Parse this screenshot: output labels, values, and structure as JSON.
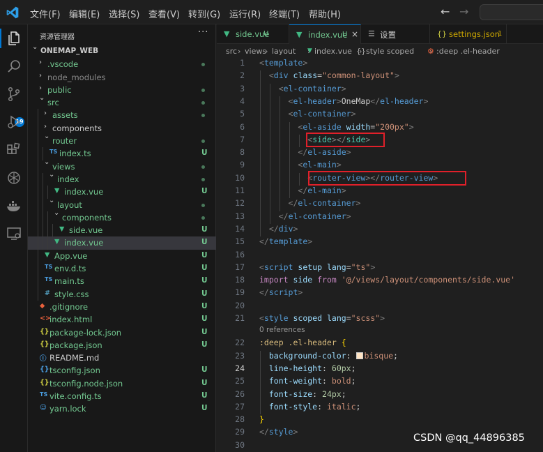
{
  "menu": [
    "文件(F)",
    "编辑(E)",
    "选择(S)",
    "查看(V)",
    "转到(G)",
    "运行(R)",
    "终端(T)",
    "帮助(H)"
  ],
  "activity": {
    "scm_badge": "19"
  },
  "sidebar": {
    "title": "资源管理器",
    "more": "···",
    "project": "ONEMAP_WEB",
    "items": [
      {
        "label": ".vscode",
        "indent": 1,
        "kind": "folder-closed",
        "status": "dot"
      },
      {
        "label": "node_modules",
        "indent": 1,
        "kind": "folder-closed",
        "status": "",
        "dim": true
      },
      {
        "label": "public",
        "indent": 1,
        "kind": "folder-closed",
        "status": "dot"
      },
      {
        "label": "src",
        "indent": 1,
        "kind": "folder-open",
        "status": "dot"
      },
      {
        "label": "assets",
        "indent": 2,
        "kind": "folder-closed",
        "status": "dot"
      },
      {
        "label": "components",
        "indent": 2,
        "kind": "folder-closed",
        "status": ""
      },
      {
        "label": "router",
        "indent": 2,
        "kind": "folder-open",
        "status": "dot"
      },
      {
        "label": "index.ts",
        "indent": 3,
        "kind": "ts",
        "status": "U"
      },
      {
        "label": "views",
        "indent": 2,
        "kind": "folder-open",
        "status": "dot"
      },
      {
        "label": "index",
        "indent": 3,
        "kind": "folder-open",
        "status": "dot"
      },
      {
        "label": "index.vue",
        "indent": 4,
        "kind": "vue",
        "status": "U"
      },
      {
        "label": "layout",
        "indent": 3,
        "kind": "folder-open",
        "status": "dot"
      },
      {
        "label": "components",
        "indent": 4,
        "kind": "folder-open",
        "status": "dot"
      },
      {
        "label": "side.vue",
        "indent": 5,
        "kind": "vue",
        "status": "U"
      },
      {
        "label": "index.vue",
        "indent": 4,
        "kind": "vue",
        "status": "U",
        "selected": true
      },
      {
        "label": "App.vue",
        "indent": 2,
        "kind": "vue",
        "status": "U"
      },
      {
        "label": "env.d.ts",
        "indent": 2,
        "kind": "ts",
        "status": "U"
      },
      {
        "label": "main.ts",
        "indent": 2,
        "kind": "ts",
        "status": "U"
      },
      {
        "label": "style.css",
        "indent": 2,
        "kind": "css",
        "status": "U"
      },
      {
        "label": ".gitignore",
        "indent": 1,
        "kind": "git",
        "status": "U"
      },
      {
        "label": "index.html",
        "indent": 1,
        "kind": "html",
        "status": "U"
      },
      {
        "label": "package-lock.json",
        "indent": 1,
        "kind": "json",
        "status": "U"
      },
      {
        "label": "package.json",
        "indent": 1,
        "kind": "json",
        "status": "U"
      },
      {
        "label": "README.md",
        "indent": 1,
        "kind": "md",
        "status": ""
      },
      {
        "label": "tsconfig.json",
        "indent": 1,
        "kind": "tsconfig",
        "status": "U"
      },
      {
        "label": "tsconfig.node.json",
        "indent": 1,
        "kind": "json",
        "status": "U"
      },
      {
        "label": "vite.config.ts",
        "indent": 1,
        "kind": "vite",
        "status": "U"
      },
      {
        "label": "yarn.lock",
        "indent": 1,
        "kind": "yarn",
        "status": "U"
      }
    ]
  },
  "tabs": [
    {
      "label": "side.vue",
      "flag": "U",
      "kind": "vue",
      "active": false
    },
    {
      "label": "index.vue",
      "flag": "U",
      "kind": "vue",
      "active": true,
      "close": "×"
    },
    {
      "label": "设置",
      "flag": "",
      "kind": "settings",
      "active": false
    },
    {
      "label": "settings.json",
      "flag": "1",
      "kind": "json",
      "active": false
    }
  ],
  "breadcrumb": [
    "src",
    "views",
    "layout",
    "index.vue",
    "style scoped",
    ":deep .el-header"
  ],
  "codelens": "0 references",
  "current_line": 24,
  "code": [
    {
      "n": "1",
      "tokens": [
        [
          "br",
          "<"
        ],
        [
          "tag",
          "template"
        ],
        [
          "br",
          ">"
        ]
      ]
    },
    {
      "n": "2",
      "tokens": [
        [
          "plain",
          "  "
        ],
        [
          "br",
          "<"
        ],
        [
          "tag",
          "div"
        ],
        [
          "plain",
          " "
        ],
        [
          "attr",
          "class"
        ],
        [
          "plain",
          "="
        ],
        [
          "str",
          "\"common-layout\""
        ],
        [
          "br",
          ">"
        ]
      ]
    },
    {
      "n": "3",
      "tokens": [
        [
          "plain",
          "    "
        ],
        [
          "br",
          "<"
        ],
        [
          "tag",
          "el-container"
        ],
        [
          "br",
          ">"
        ]
      ]
    },
    {
      "n": "4",
      "tokens": [
        [
          "plain",
          "      "
        ],
        [
          "br",
          "<"
        ],
        [
          "tag",
          "el-header"
        ],
        [
          "br",
          ">"
        ],
        [
          "plain",
          "OneMap"
        ],
        [
          "br",
          "</"
        ],
        [
          "tag",
          "el-header"
        ],
        [
          "br",
          ">"
        ]
      ]
    },
    {
      "n": "5",
      "tokens": [
        [
          "plain",
          "      "
        ],
        [
          "br",
          "<"
        ],
        [
          "tag",
          "el-container"
        ],
        [
          "br",
          ">"
        ]
      ]
    },
    {
      "n": "6",
      "tokens": [
        [
          "plain",
          "        "
        ],
        [
          "br",
          "<"
        ],
        [
          "tag",
          "el-aside"
        ],
        [
          "plain",
          " "
        ],
        [
          "attr",
          "width"
        ],
        [
          "plain",
          "="
        ],
        [
          "str",
          "\"200px\""
        ],
        [
          "br",
          ">"
        ]
      ]
    },
    {
      "n": "7",
      "tokens": [
        [
          "plain",
          "          "
        ],
        [
          "br",
          "<"
        ],
        [
          "comp",
          "side"
        ],
        [
          "br",
          "></"
        ],
        [
          "comp",
          "side"
        ],
        [
          "br",
          ">"
        ]
      ]
    },
    {
      "n": "8",
      "tokens": [
        [
          "plain",
          "        "
        ],
        [
          "br",
          "</"
        ],
        [
          "tag",
          "el-aside"
        ],
        [
          "br",
          ">"
        ]
      ]
    },
    {
      "n": "9",
      "tokens": [
        [
          "plain",
          "        "
        ],
        [
          "br",
          "<"
        ],
        [
          "tag",
          "el-main"
        ],
        [
          "br",
          ">"
        ]
      ]
    },
    {
      "n": "10",
      "tokens": [
        [
          "plain",
          "          "
        ],
        [
          "br",
          "<"
        ],
        [
          "tag",
          "router-view"
        ],
        [
          "br",
          "></"
        ],
        [
          "tag",
          "router-view"
        ],
        [
          "br",
          ">"
        ]
      ]
    },
    {
      "n": "11",
      "tokens": [
        [
          "plain",
          "        "
        ],
        [
          "br",
          "</"
        ],
        [
          "tag",
          "el-main"
        ],
        [
          "br",
          ">"
        ]
      ]
    },
    {
      "n": "12",
      "tokens": [
        [
          "plain",
          "      "
        ],
        [
          "br",
          "</"
        ],
        [
          "tag",
          "el-container"
        ],
        [
          "br",
          ">"
        ]
      ]
    },
    {
      "n": "13",
      "tokens": [
        [
          "plain",
          "    "
        ],
        [
          "br",
          "</"
        ],
        [
          "tag",
          "el-container"
        ],
        [
          "br",
          ">"
        ]
      ]
    },
    {
      "n": "14",
      "tokens": [
        [
          "plain",
          "  "
        ],
        [
          "br",
          "</"
        ],
        [
          "tag",
          "div"
        ],
        [
          "br",
          ">"
        ]
      ]
    },
    {
      "n": "15",
      "tokens": [
        [
          "br",
          "</"
        ],
        [
          "tag",
          "template"
        ],
        [
          "br",
          ">"
        ]
      ]
    },
    {
      "n": "16",
      "tokens": []
    },
    {
      "n": "17",
      "tokens": [
        [
          "br",
          "<"
        ],
        [
          "tag",
          "script"
        ],
        [
          "plain",
          " "
        ],
        [
          "attr",
          "setup"
        ],
        [
          "plain",
          " "
        ],
        [
          "attr",
          "lang"
        ],
        [
          "plain",
          "="
        ],
        [
          "str",
          "\"ts\""
        ],
        [
          "br",
          ">"
        ]
      ]
    },
    {
      "n": "18",
      "tokens": [
        [
          "kw",
          "import"
        ],
        [
          "plain",
          " "
        ],
        [
          "attr",
          "side"
        ],
        [
          "plain",
          " "
        ],
        [
          "kw",
          "from"
        ],
        [
          "plain",
          " "
        ],
        [
          "str",
          "'@/views/layout/components/side.vue'"
        ]
      ]
    },
    {
      "n": "19",
      "tokens": [
        [
          "br",
          "</"
        ],
        [
          "tag",
          "script"
        ],
        [
          "br",
          ">"
        ]
      ]
    },
    {
      "n": "20",
      "tokens": []
    },
    {
      "n": "21",
      "tokens": [
        [
          "br",
          "<"
        ],
        [
          "tag",
          "style"
        ],
        [
          "plain",
          " "
        ],
        [
          "attr",
          "scoped"
        ],
        [
          "plain",
          " "
        ],
        [
          "attr",
          "lang"
        ],
        [
          "plain",
          "="
        ],
        [
          "str",
          "\"scss\""
        ],
        [
          "br",
          ">"
        ]
      ]
    },
    {
      "n": "22",
      "tokens": [
        [
          "sel",
          ":deep .el-header"
        ],
        [
          "plain",
          " "
        ],
        [
          "brace",
          "{"
        ]
      ]
    },
    {
      "n": "23",
      "tokens": [
        [
          "plain",
          "  "
        ],
        [
          "prop",
          "background-color"
        ],
        [
          "plain",
          ": "
        ],
        [
          "swatch",
          ""
        ],
        [
          "val",
          "bisque"
        ],
        [
          "plain",
          ";"
        ]
      ]
    },
    {
      "n": "24",
      "tokens": [
        [
          "plain",
          "  "
        ],
        [
          "prop",
          "line-height"
        ],
        [
          "plain",
          ": "
        ],
        [
          "num",
          "60px"
        ],
        [
          "plain",
          ";"
        ]
      ]
    },
    {
      "n": "25",
      "tokens": [
        [
          "plain",
          "  "
        ],
        [
          "prop",
          "font-weight"
        ],
        [
          "plain",
          ": "
        ],
        [
          "val",
          "bold"
        ],
        [
          "plain",
          ";"
        ]
      ]
    },
    {
      "n": "26",
      "tokens": [
        [
          "plain",
          "  "
        ],
        [
          "prop",
          "font-size"
        ],
        [
          "plain",
          ": "
        ],
        [
          "num",
          "24px"
        ],
        [
          "plain",
          ";"
        ]
      ]
    },
    {
      "n": "27",
      "tokens": [
        [
          "plain",
          "  "
        ],
        [
          "prop",
          "font-style"
        ],
        [
          "plain",
          ": "
        ],
        [
          "val",
          "italic"
        ],
        [
          "plain",
          ";"
        ]
      ]
    },
    {
      "n": "28",
      "tokens": [
        [
          "brace",
          "}"
        ]
      ]
    },
    {
      "n": "29",
      "tokens": [
        [
          "br",
          "</"
        ],
        [
          "tag",
          "style"
        ],
        [
          "br",
          ">"
        ]
      ]
    },
    {
      "n": "30",
      "tokens": []
    }
  ],
  "watermark": "CSDN @qq_44896385",
  "colors": {
    "accent": "#0078d4",
    "highlight_box": "#e0202a",
    "git_untracked": "#73c991",
    "swatch_bisque": "#ffe4c4"
  }
}
